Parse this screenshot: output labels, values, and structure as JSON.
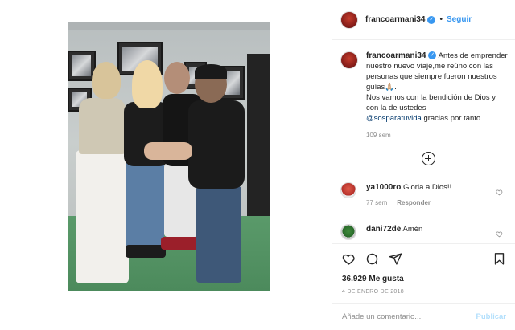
{
  "header": {
    "username": "francoarmani34",
    "separator": "•",
    "follow_label": "Seguir"
  },
  "caption": {
    "username": "francoarmani34",
    "text_1": "Antes de emprender nuestro nuevo viaje,me reúno con las personas que siempre fueron nuestros guías🙏🏼.",
    "text_2": "Nos vamos con la bendición de Dios y con la de ustedes",
    "mention": "@sosparatuvida",
    "text_3": "gracias por tanto",
    "time": "109 sem"
  },
  "comments": [
    {
      "username": "ya1000ro",
      "text": "Gloria a Dios!!",
      "time": "77 sem",
      "reply_label": "Responder"
    },
    {
      "username": "dani72de",
      "text": "Amén"
    }
  ],
  "likes": "36.929 Me gusta",
  "date": "4 DE ENERO DE 2018",
  "add_comment": {
    "placeholder": "Añade un comentario...",
    "post_label": "Publicar"
  },
  "icons": {
    "heart": "heart-icon",
    "comment": "comment-icon",
    "share": "share-icon",
    "bookmark": "bookmark-icon",
    "verified": "verified-badge-icon",
    "load_more": "plus-circle-icon"
  },
  "colors": {
    "accent": "#3897f0",
    "post_button": "#b2dffc",
    "muted": "#8e8e8e",
    "text": "#262626"
  }
}
